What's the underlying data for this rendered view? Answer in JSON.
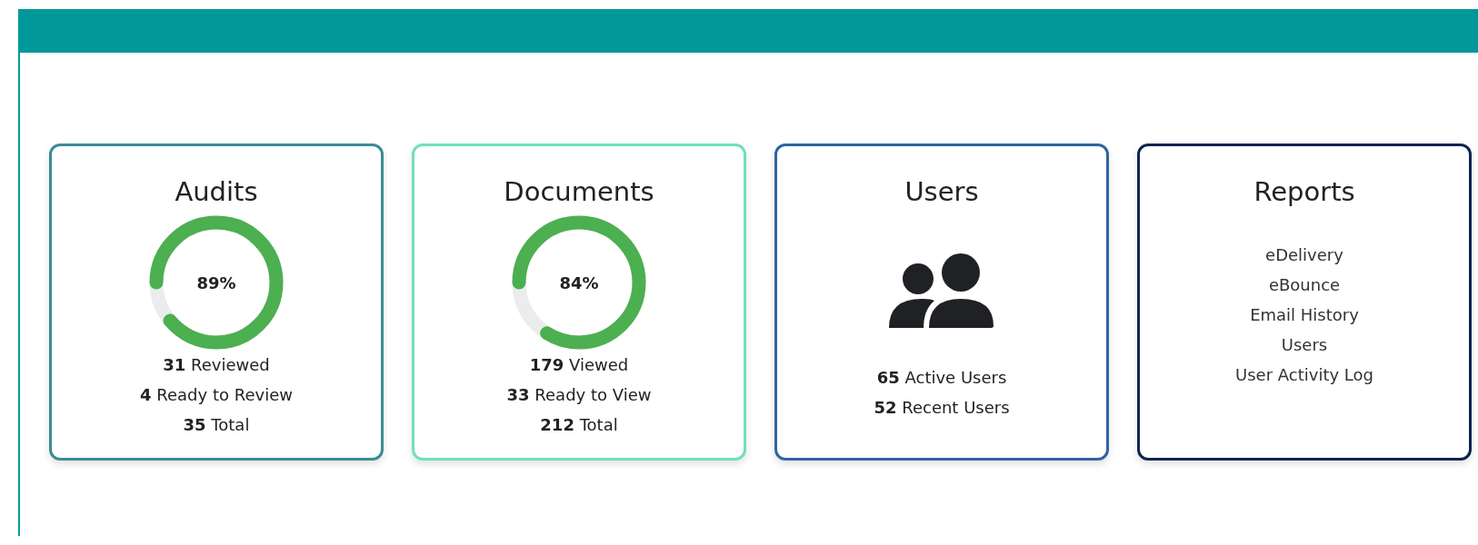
{
  "cards": [
    {
      "kind": "donut",
      "title": "Audits",
      "color": "#3b8c95",
      "level": 0.89,
      "percent": "89%",
      "stats": [
        "**31** Reviewed",
        "**4** Ready to Review",
        "**35** Total"
      ]
    },
    {
      "kind": "donut",
      "title": "Documents",
      "color": "#6fe0bb",
      "level": 0.84,
      "percent": "84%",
      "stats": [
        "**179** Viewed",
        "**33** Ready to View",
        "**212** Total"
      ]
    },
    {
      "kind": "icon",
      "title": "Users",
      "color": "#2e65a1",
      "stats": [
        "**65** Active Users",
        "**52** Recent Users"
      ]
    },
    {
      "kind": "links",
      "title": "Reports",
      "color": "#102550",
      "links": [
        "eDelivery",
        "eBounce",
        "Email History",
        "Users",
        "User Activity Log"
      ]
    }
  ]
}
